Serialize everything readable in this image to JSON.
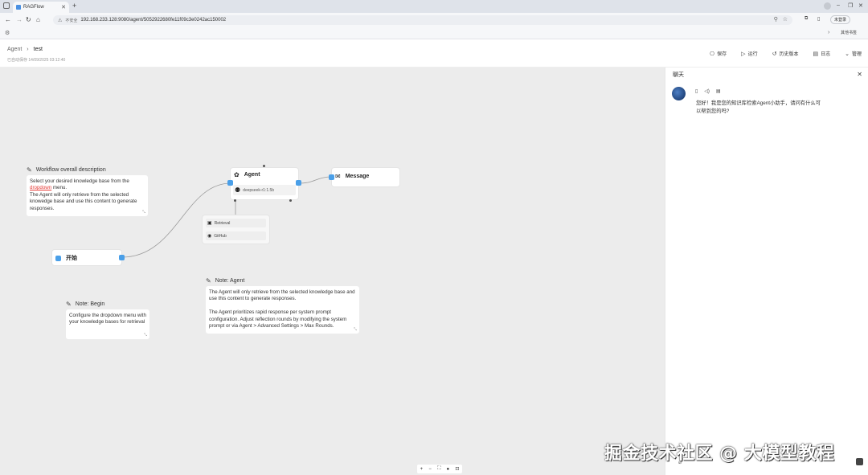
{
  "browser": {
    "tab_title": "RAGFlow",
    "tab_close": "✕",
    "new_tab": "+",
    "insecure_label": "不安全",
    "url": "192.168.233.128:9080/agent/5052922680fe11f09c3e0242ac150002",
    "login_label": "未登录",
    "bookmarks_label": "其他书签"
  },
  "header": {
    "breadcrumb_root": "Agent",
    "breadcrumb_sep": "›",
    "breadcrumb_current": "test",
    "autosave": "已自动保存 14/09/2025 03:12:40",
    "actions": [
      {
        "icon": "⎔",
        "label": "保存"
      },
      {
        "icon": "▷",
        "label": "运行"
      },
      {
        "icon": "↺",
        "label": "历史版本"
      },
      {
        "icon": "▤",
        "label": "日志"
      },
      {
        "icon": "⌄",
        "label": "管理"
      }
    ]
  },
  "canvas": {
    "workflow_note": {
      "title": "Workflow overall description",
      "line1": "Select your desired knowledge base from the",
      "link": "dropdown",
      "line1b": " menu.",
      "line2": "The Agent will only retrieve from the selected knowedge base and use this content  to generate responses."
    },
    "agent_node": {
      "title": "Agent",
      "model": "deepseek-r1:1.5b"
    },
    "message_node": {
      "title": "Message"
    },
    "tools": [
      {
        "label": "Retrieval"
      },
      {
        "label": "GitHub"
      }
    ],
    "begin_node": {
      "title": "开始"
    },
    "note_agent": {
      "title": "Note: Agent",
      "p1": "The Agent will only retrieve from the selected knowledge base and use this content  to generate responses.",
      "p2": "The Agent prioritizes rapid response per system prompt configuration. Adjust reflection rounds by modifying the system prompt or via Agent > Advanced Settings > Max Rounds."
    },
    "note_begin": {
      "title": "Note: Begin",
      "body": "Configure the dropdown menu with your knowledge bases for retrieval"
    },
    "zoom_toolbar": [
      "+",
      "−",
      "⛶",
      "●",
      "⊡"
    ]
  },
  "chat": {
    "title": "聊天",
    "message": "您好！我是您的知识库检索Agent小助手，请问有什么可以帮到您的吗?"
  },
  "watermark": "掘金技术社区 @ 大模型教程"
}
